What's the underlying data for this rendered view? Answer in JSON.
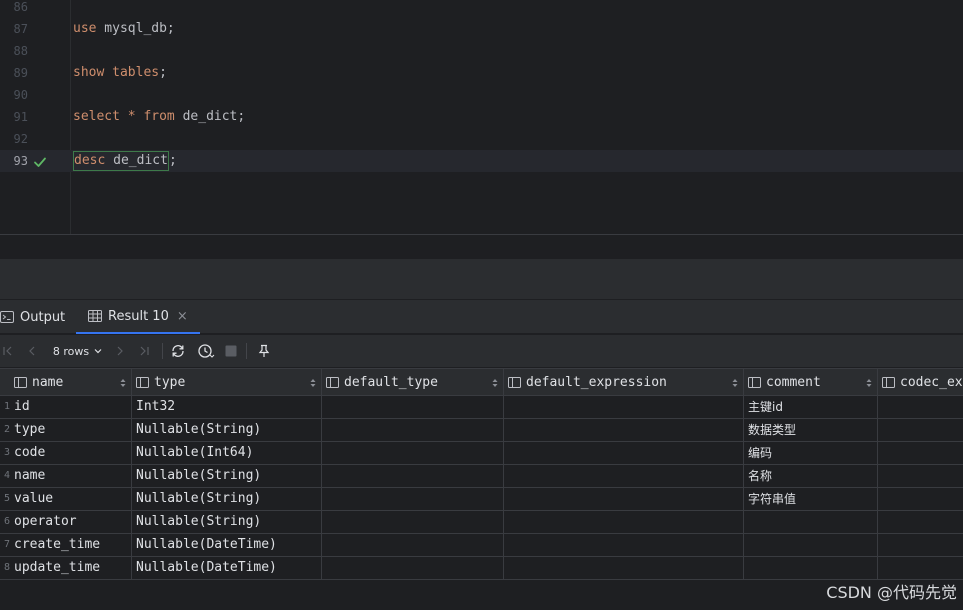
{
  "editor": {
    "lines": [
      {
        "num": "86"
      },
      {
        "num": "87",
        "kw": "use",
        "rest": " mysql_db;"
      },
      {
        "num": "88"
      },
      {
        "num": "89",
        "kw": "show",
        "kw2": " tables",
        "rest": ";"
      },
      {
        "num": "90"
      },
      {
        "num": "91",
        "kw": "select",
        "star": " * ",
        "kw2": "from",
        "rest": " de_dict;"
      },
      {
        "num": "92"
      },
      {
        "num": "93",
        "kw": "desc",
        "rest": " de_dict",
        "tail": ";"
      }
    ],
    "current_line_status_icon": "check-icon"
  },
  "tabs": [
    {
      "label": "Output",
      "icon": "terminal-icon",
      "active": false
    },
    {
      "label": "Result 10",
      "icon": "table-icon",
      "active": true,
      "close": "×"
    }
  ],
  "toolbar": {
    "rows_label": "8 rows",
    "icons": [
      "first-page-icon",
      "prev-page-icon",
      "next-page-icon",
      "last-page-icon",
      "refresh-icon",
      "history-icon",
      "stop-icon",
      "pin-icon"
    ]
  },
  "grid": {
    "columns": [
      "name",
      "type",
      "default_type",
      "default_expression",
      "comment",
      "codec_ex"
    ],
    "rows": [
      {
        "n": "1",
        "cells": [
          "id",
          "Int32",
          "",
          "",
          "主键id",
          ""
        ]
      },
      {
        "n": "2",
        "cells": [
          "type",
          "Nullable(String)",
          "",
          "",
          "数据类型",
          ""
        ]
      },
      {
        "n": "3",
        "cells": [
          "code",
          "Nullable(Int64)",
          "",
          "",
          "编码",
          ""
        ]
      },
      {
        "n": "4",
        "cells": [
          "name",
          "Nullable(String)",
          "",
          "",
          "名称",
          ""
        ]
      },
      {
        "n": "5",
        "cells": [
          "value",
          "Nullable(String)",
          "",
          "",
          "字符串值",
          ""
        ]
      },
      {
        "n": "6",
        "cells": [
          "operator",
          "Nullable(String)",
          "",
          "",
          "",
          ""
        ]
      },
      {
        "n": "7",
        "cells": [
          "create_time",
          "Nullable(DateTime)",
          "",
          "",
          "",
          ""
        ]
      },
      {
        "n": "8",
        "cells": [
          "update_time",
          "Nullable(DateTime)",
          "",
          "",
          "",
          ""
        ]
      }
    ]
  },
  "watermark": "CSDN @代码先觉",
  "colors": {
    "keyword": "#cf8e6d",
    "accent": "#3574f0",
    "check": "#5fb865"
  }
}
